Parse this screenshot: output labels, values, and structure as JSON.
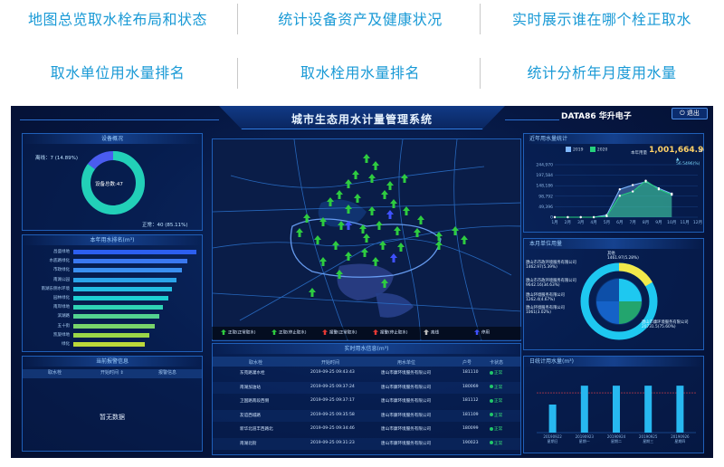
{
  "captions": [
    "地图总览取水栓布局和状态",
    "统计设备资产及健康状况",
    "实时展示谁在哪个栓正取水",
    "取水单位用水量排名",
    "取水栓用水量排名",
    "统计分析年月度用水量"
  ],
  "header": {
    "title": "城市生态用水计量管理系统",
    "brand": "DATA86 华升电子",
    "exit_label": "退出"
  },
  "device_panel": {
    "title": "设备概况",
    "offline_label": "离线：7 (14.89%)",
    "center_label": "设备总数:47",
    "online_label": "正常：40 (85.11%)",
    "online_pct": 85.11,
    "offline_pct": 14.89
  },
  "rank_panel": {
    "title": "本年用水排名(m³)",
    "rows": [
      {
        "name": "昌盛绿地",
        "value": 100,
        "color": "#2c5ff0"
      },
      {
        "name": "水底路绿化",
        "value": 93,
        "color": "#3a78f0"
      },
      {
        "name": "市政绿化",
        "value": 88,
        "color": "#3a8ff0"
      },
      {
        "name": "南湖公园",
        "value": 84,
        "color": "#2ba4ea"
      },
      {
        "name": "南湖东侧水环境",
        "value": 80,
        "color": "#23bce2"
      },
      {
        "name": "园林绿化",
        "value": 77,
        "color": "#1dcfd2"
      },
      {
        "name": "南岸绿地",
        "value": 73,
        "color": "#2fd3b4"
      },
      {
        "name": "滨湖路",
        "value": 70,
        "color": "#53d290"
      },
      {
        "name": "五十街",
        "value": 66,
        "color": "#78d46a"
      },
      {
        "name": "凯旋绿地",
        "value": 62,
        "color": "#9cd648"
      },
      {
        "name": "绿化",
        "value": 58,
        "color": "#bcd83a"
      }
    ]
  },
  "alarm_panel": {
    "title": "当前报警信息",
    "columns": [
      "取水栓",
      "开始时间 ⇕",
      "报警信息"
    ],
    "empty_text": "暂无数据"
  },
  "map": {
    "legend": [
      {
        "label": "正取(正常取水)",
        "color": "#2ecc40"
      },
      {
        "label": "正取(停止取水)",
        "color": "#2ecc40"
      },
      {
        "label": "报警(正常取水)",
        "color": "#e53935"
      },
      {
        "label": "报警(停止取水)",
        "color": "#e53935"
      },
      {
        "label": "离线",
        "color": "#bdbdbd"
      },
      {
        "label": "停用",
        "color": "#3f51ff"
      }
    ]
  },
  "realtime_panel": {
    "title": "实时用水信息(m³)",
    "columns": [
      "取水栓",
      "开始时间",
      "用水单位",
      "户号",
      "卡状态"
    ],
    "rows": [
      {
        "name": "东苑路灌水栓",
        "time": "2019-09-25 09:43:43",
        "unit": "唐山市康环境服务有限公司",
        "no": "181110",
        "status": "正常"
      },
      {
        "name": "南湖加油站",
        "time": "2019-09-25 09:37:24",
        "unit": "唐山市康环境服务有限公司",
        "no": "180069",
        "status": "正常"
      },
      {
        "name": "卫国路南段西侧",
        "time": "2019-09-25 09:37:17",
        "unit": "唐山市康环境服务有限公司",
        "no": "181112",
        "status": "正常"
      },
      {
        "name": "友谊西城路",
        "time": "2019-09-25 09:35:58",
        "unit": "唐山市康环境服务有限公司",
        "no": "181109",
        "status": "正常"
      },
      {
        "name": "新华北道丰西路北",
        "time": "2019-09-25 09:34:46",
        "unit": "唐山市康环境服务有限公司",
        "no": "180099",
        "status": "正常"
      },
      {
        "name": "南湖北街",
        "time": "2019-09-25 09:31:23",
        "unit": "唐山市康环境服务有限公司",
        "no": "190023",
        "status": "正常"
      }
    ]
  },
  "trend_panel": {
    "title": "近年用水量统计",
    "legend": [
      "2019",
      "2020"
    ],
    "total_label": "本年用量",
    "total_value": "1,001,664.9",
    "unit": "m³",
    "change": "▲ 56.5496(%)",
    "yticks": [
      "244,970",
      "197,584",
      "148,186",
      "98,792",
      "49,396",
      "0"
    ],
    "xticks": [
      "1月",
      "2月",
      "3月",
      "4月",
      "5月",
      "6月",
      "7月",
      "8月",
      "9月",
      "10月",
      "11月",
      "12月"
    ]
  },
  "chart_data": [
    {
      "type": "area",
      "title": "近年用水量统计",
      "categories": [
        "1月",
        "2月",
        "3月",
        "4月",
        "5月",
        "6月",
        "7月",
        "8月",
        "9月",
        "10月",
        "11月",
        "12月"
      ],
      "ylim": [
        0,
        244970
      ],
      "series": [
        {
          "name": "2019",
          "values": [
            0,
            0,
            0,
            0,
            10000,
            130000,
            150000,
            165000,
            135000,
            110000,
            null,
            null
          ]
        },
        {
          "name": "2020",
          "values": [
            0,
            0,
            0,
            0,
            5000,
            100000,
            120000,
            170000,
            130000,
            105000,
            null,
            null
          ]
        }
      ]
    },
    {
      "type": "bar",
      "title": "日统计用水量",
      "categories": [
        "20190922\n星期日",
        "20190923\n星期一",
        "20190924\n星期二",
        "20190925\n星期三",
        "20190926\n星期四"
      ],
      "values": [
        55,
        92,
        92,
        92,
        92
      ],
      "ylim": [
        0,
        110
      ]
    }
  ],
  "pie_panel": {
    "title": "本月单位用量",
    "labels": [
      "其他\n1461.97(5.28%)",
      "唐山市市政环境服务有限公司\n1462.97(5.39%)",
      "唐山市市政环境服务有限公司\n9642.16(34.63%)",
      "唐山环境服务有限公司\n1262.4(4.67%)",
      "唐山环境服务有限公司\n1061(3.02%)",
      "唐山市康环境服务有限公司\n20731.5(75.60%)"
    ]
  },
  "daily_panel": {
    "title": "日统计用水量(m³)"
  }
}
